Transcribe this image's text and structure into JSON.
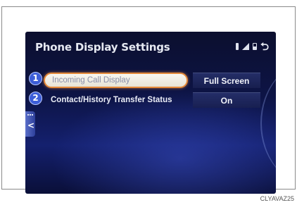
{
  "screen": {
    "title": "Phone Display Settings",
    "status_icons": [
      "bluetooth-icon",
      "signal-icon",
      "battery-icon"
    ],
    "back_icon": "back-arrow-icon"
  },
  "items": [
    {
      "number": "1",
      "label": "Incoming Call Display",
      "value": "Full Screen",
      "selected": true
    },
    {
      "number": "2",
      "label": "Contact/History Transfer Status",
      "value": "On",
      "selected": false
    }
  ],
  "caption": "CLYAVAZ25",
  "colors": {
    "accent": "#e58a3a",
    "badge": "#3d5ed8",
    "background": "#0d1446"
  }
}
